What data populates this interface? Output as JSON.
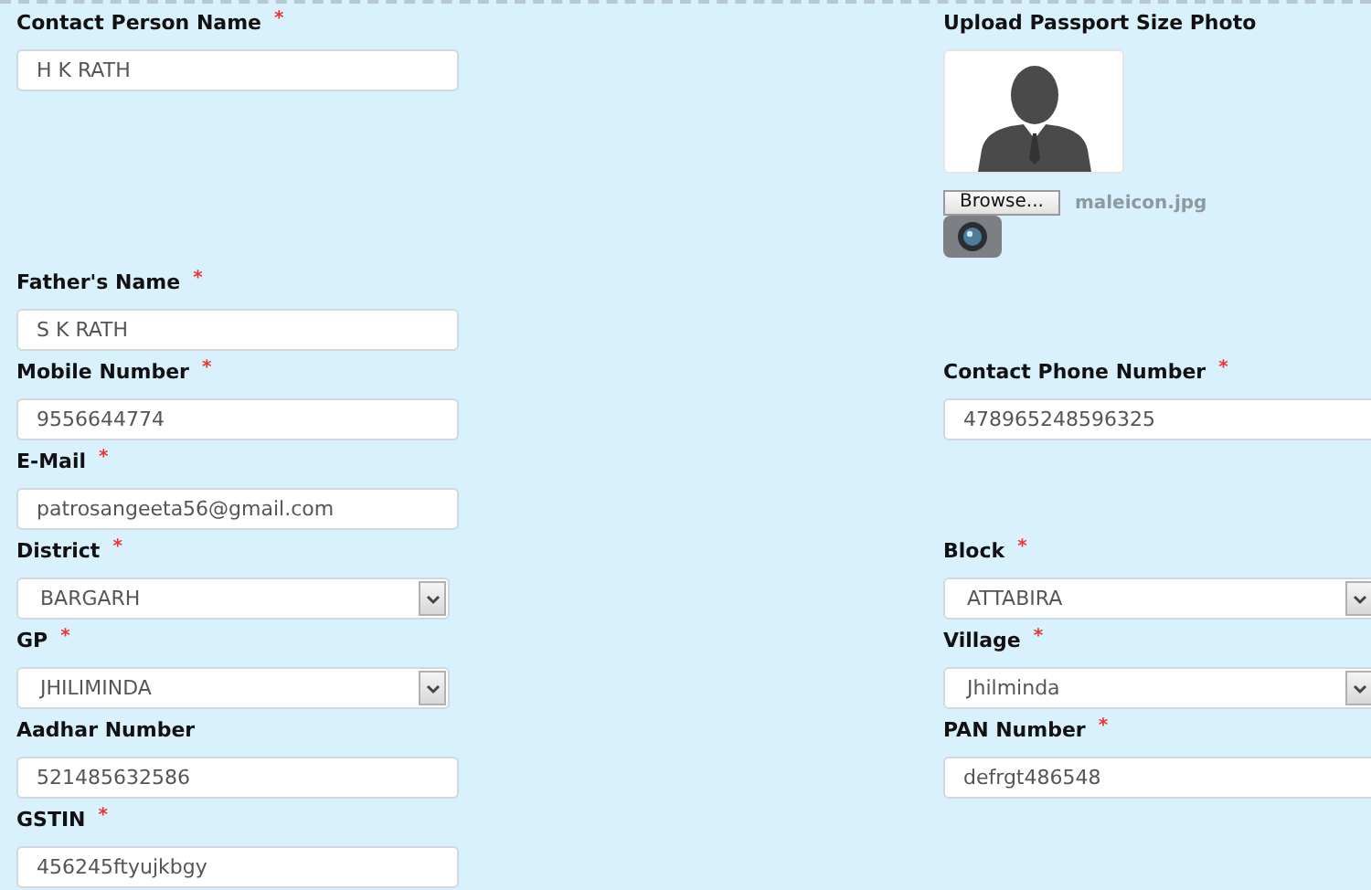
{
  "rows": [
    {
      "left": {
        "label": "Contact Person Name",
        "required_mark": "*",
        "kind": "text",
        "value": "H K RATH"
      },
      "right": {
        "kind": "photo",
        "label": "Upload Passport Size Photo",
        "button": "Browse...",
        "file_name": "maleicon.jpg"
      }
    },
    {
      "left": {
        "label": "Father's Name",
        "required_mark": "*",
        "kind": "text",
        "value": "S K RATH"
      }
    },
    {
      "left": {
        "label": "Mobile Number",
        "required_mark": "*",
        "kind": "text",
        "value": "9556644774"
      },
      "right": {
        "label": "Contact Phone Number",
        "required_mark": "*",
        "kind": "text",
        "value": "478965248596325"
      }
    },
    {
      "left": {
        "label": "E-Mail",
        "required_mark": "*",
        "kind": "text",
        "value": "patrosangeeta56@gmail.com"
      }
    },
    {
      "left": {
        "label": "District",
        "required_mark": "*",
        "kind": "select",
        "value": "BARGARH"
      },
      "right": {
        "label": "Block",
        "required_mark": "*",
        "kind": "select",
        "value": "ATTABIRA"
      }
    },
    {
      "left": {
        "label": "GP",
        "required_mark": "*",
        "kind": "select",
        "value": "JHILIMINDA"
      },
      "right": {
        "label": "Village",
        "required_mark": "*",
        "kind": "select",
        "value": "Jhilminda"
      }
    },
    {
      "left": {
        "label": "Aadhar Number",
        "kind": "text",
        "value": "521485632586"
      },
      "right": {
        "label": "PAN Number",
        "required_mark": "*",
        "kind": "text",
        "value": "defrgt486548"
      }
    },
    {
      "left": {
        "label": "GSTIN",
        "required_mark": "*",
        "kind": "text",
        "value": "456245ftyujkbgy"
      }
    }
  ]
}
